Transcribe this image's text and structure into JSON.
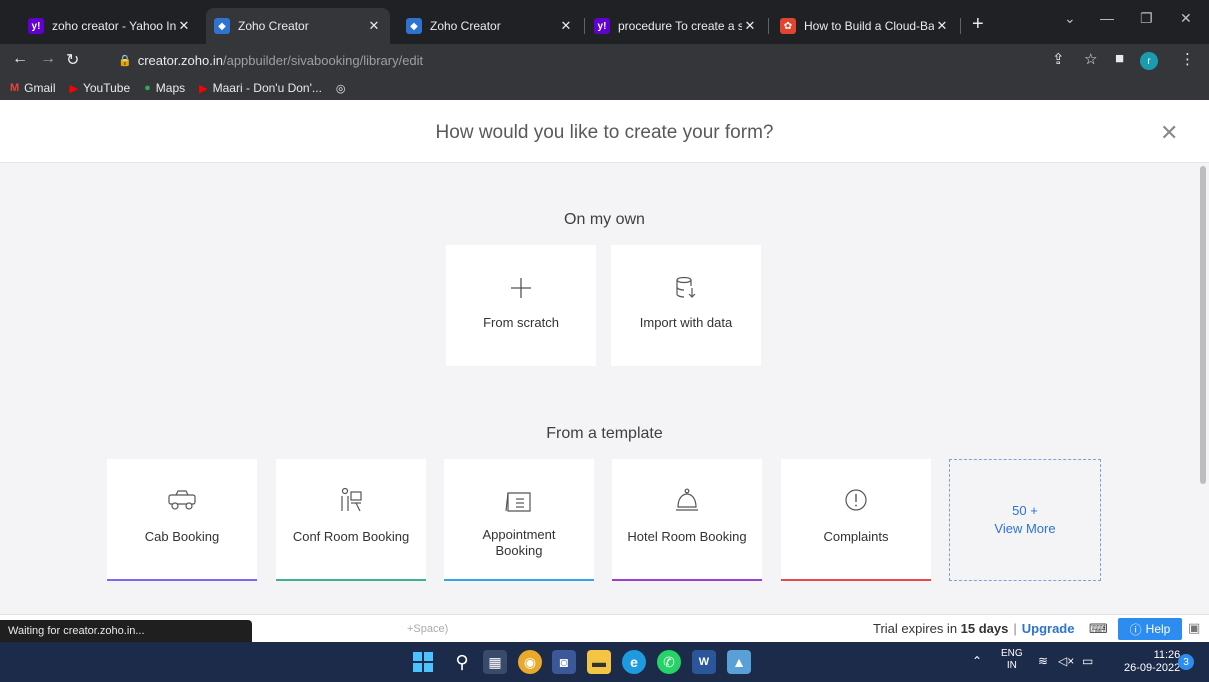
{
  "browser": {
    "tabs": [
      {
        "label": "zoho creator - Yahoo Indi",
        "favicon": "yahoo-icon",
        "color": "#6001d2",
        "glyph": "y!"
      },
      {
        "label": "Zoho Creator",
        "favicon": "zoho-creator-icon",
        "color": "#2d73d0",
        "glyph": "◆"
      },
      {
        "label": "Zoho Creator",
        "favicon": "zoho-creator-icon",
        "color": "#2d73d0",
        "glyph": "◆"
      },
      {
        "label": "procedure To create a sim",
        "favicon": "yahoo-icon",
        "color": "#6001d2",
        "glyph": "y!"
      },
      {
        "label": "How to Build a Cloud-Bas",
        "favicon": "web-icon",
        "color": "#e2442f",
        "glyph": "✿"
      }
    ],
    "url_host": "creator.zoho.in",
    "url_path": "/appbuilder/sivabooking/library/edit",
    "profile_initial": "r",
    "bookmarks": [
      {
        "label": "Gmail",
        "icon": "gmail-icon",
        "glyph": "M",
        "color": "#ea4335"
      },
      {
        "label": "YouTube",
        "icon": "youtube-icon",
        "glyph": "▶",
        "color": "#ff0000"
      },
      {
        "label": "Maps",
        "icon": "maps-icon",
        "glyph": "●",
        "color": "#34a853"
      },
      {
        "label": "Maari - Don'u Don'...",
        "icon": "youtube-icon",
        "glyph": "▶",
        "color": "#ff0000"
      },
      {
        "label": "",
        "icon": "globe-icon",
        "glyph": "🌐",
        "color": "#e8eaed"
      }
    ]
  },
  "modal": {
    "title": "How would you like to create your form?",
    "on_my_own_heading": "On my own",
    "from_scratch": "From scratch",
    "import_with_data": "Import with data",
    "template_heading": "From a template",
    "templates": [
      {
        "label": "Cab Booking",
        "icon": "car-icon",
        "accent": "#7b68ee"
      },
      {
        "label": "Conf Room Booking",
        "icon": "meeting-room-icon",
        "accent": "#3db38a"
      },
      {
        "label": "Appointment Booking",
        "icon": "clipboard-list-icon",
        "accent": "#2fa8e0"
      },
      {
        "label": "Hotel Room Booking",
        "icon": "service-bell-icon",
        "accent": "#9b3fd1"
      },
      {
        "label": "Complaints",
        "icon": "exclamation-circle-icon",
        "accent": "#e5484d"
      }
    ],
    "more_count": "50 +",
    "more_label": "View More"
  },
  "status": {
    "loading": "Waiting for creator.zoho.in...",
    "hint": "+Space)",
    "trial_prefix": "Trial expires in ",
    "trial_days": "15 days",
    "upgrade": "Upgrade",
    "help": "Help"
  },
  "taskbar": {
    "lang": "ENG",
    "region": "IN",
    "time": "11:26",
    "date": "26-09-2022",
    "notifications": "3"
  }
}
